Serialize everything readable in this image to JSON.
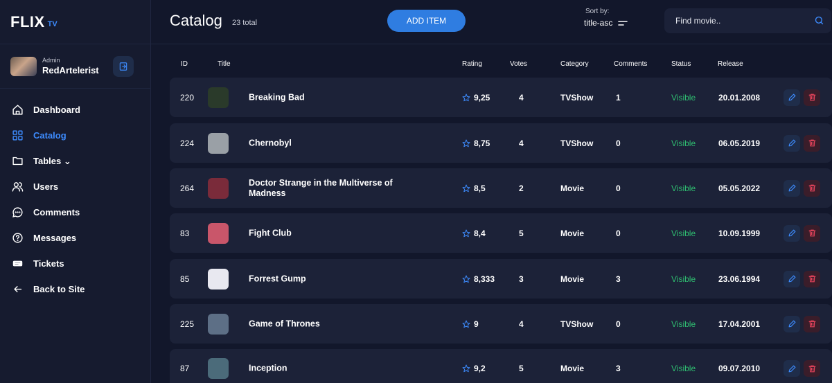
{
  "brand": {
    "name": "FLIX",
    "sub": "TV"
  },
  "user": {
    "role": "Admin",
    "name": "RedArtelerist"
  },
  "nav": [
    {
      "label": "Dashboard",
      "icon": "home-icon",
      "active": false
    },
    {
      "label": "Catalog",
      "icon": "grid-icon",
      "active": true
    },
    {
      "label": "Tables ⌄",
      "icon": "folder-icon",
      "active": false
    },
    {
      "label": "Users",
      "icon": "users-icon",
      "active": false
    },
    {
      "label": "Comments",
      "icon": "comment-icon",
      "active": false
    },
    {
      "label": "Messages",
      "icon": "help-icon",
      "active": false
    },
    {
      "label": "Tickets",
      "icon": "ticket-icon",
      "active": false
    },
    {
      "label": "Back to Site",
      "icon": "arrow-left-icon",
      "active": false
    }
  ],
  "header": {
    "title": "Catalog",
    "total": "23 total",
    "add_label": "ADD ITEM",
    "sort_label": "Sort by:",
    "sort_value": "title-asc",
    "search_placeholder": "Find movie.."
  },
  "columns": [
    "ID",
    "Title",
    "Rating",
    "Votes",
    "Category",
    "Comments",
    "Status",
    "Release"
  ],
  "rows": [
    {
      "id": "220",
      "title": "Breaking Bad",
      "rating": "9,25",
      "votes": "4",
      "category": "TVShow",
      "comments": "1",
      "status": "Visible",
      "release": "20.01.2008",
      "thumb": "#2a3a2a"
    },
    {
      "id": "224",
      "title": "Chernobyl",
      "rating": "8,75",
      "votes": "4",
      "category": "TVShow",
      "comments": "0",
      "status": "Visible",
      "release": "06.05.2019",
      "thumb": "#9aa0a6"
    },
    {
      "id": "264",
      "title": "Doctor Strange in the Multiverse of Madness",
      "rating": "8,5",
      "votes": "2",
      "category": "Movie",
      "comments": "0",
      "status": "Visible",
      "release": "05.05.2022",
      "thumb": "#7a2b3a"
    },
    {
      "id": "83",
      "title": "Fight Club",
      "rating": "8,4",
      "votes": "5",
      "category": "Movie",
      "comments": "0",
      "status": "Visible",
      "release": "10.09.1999",
      "thumb": "#c9566a"
    },
    {
      "id": "85",
      "title": "Forrest Gump",
      "rating": "8,333",
      "votes": "3",
      "category": "Movie",
      "comments": "3",
      "status": "Visible",
      "release": "23.06.1994",
      "thumb": "#e8e8f0"
    },
    {
      "id": "225",
      "title": "Game of Thrones",
      "rating": "9",
      "votes": "4",
      "category": "TVShow",
      "comments": "0",
      "status": "Visible",
      "release": "17.04.2001",
      "thumb": "#5d6f86"
    },
    {
      "id": "87",
      "title": "Inception",
      "rating": "9,2",
      "votes": "5",
      "category": "Movie",
      "comments": "3",
      "status": "Visible",
      "release": "09.07.2010",
      "thumb": "#4b6b7a"
    }
  ],
  "colors": {
    "accent": "#3d8bfd",
    "visible": "#2fbf71",
    "delete": "#e8445c",
    "row_bg": "#1c2238"
  }
}
